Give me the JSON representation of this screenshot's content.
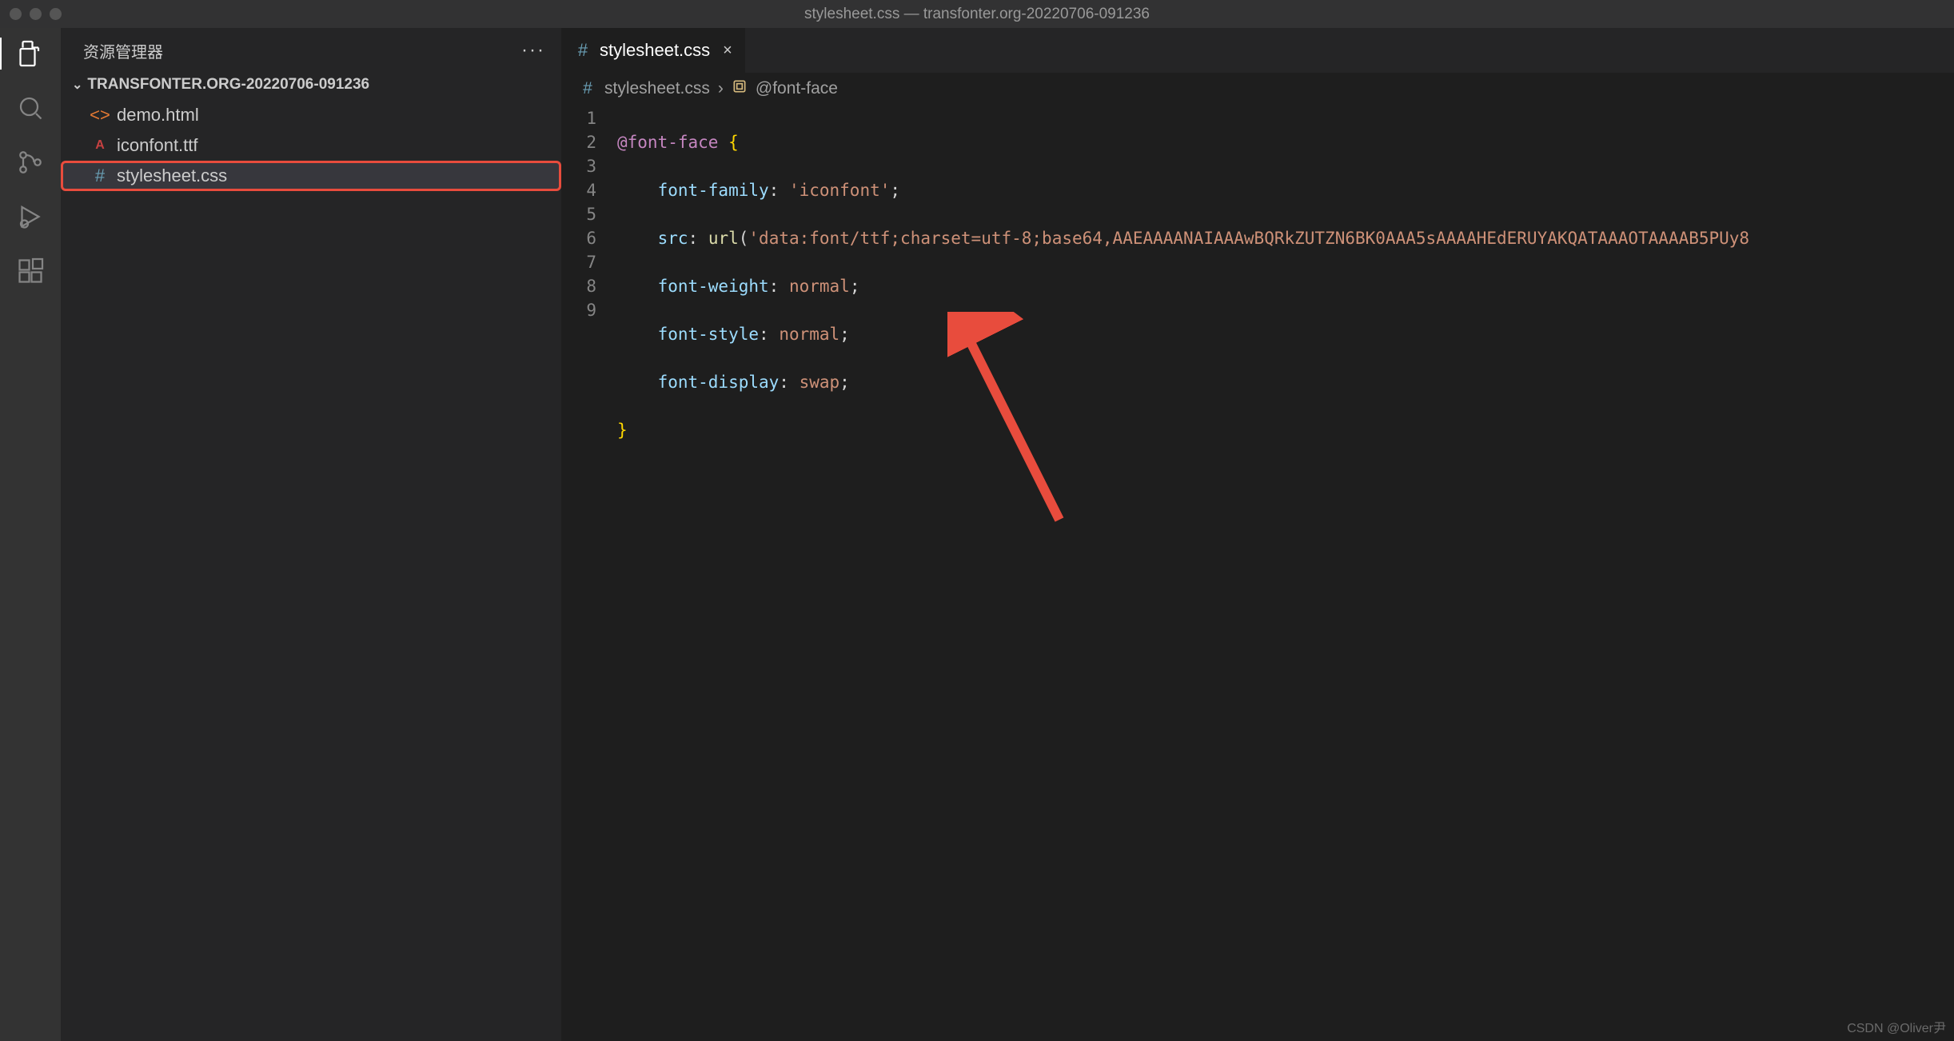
{
  "window": {
    "title": "stylesheet.css — transfonter.org-20220706-091236"
  },
  "sidebar": {
    "title": "资源管理器",
    "folder": "TRANSFONTER.ORG-20220706-091236",
    "files": [
      {
        "name": "demo.html",
        "icon": "html"
      },
      {
        "name": "iconfont.ttf",
        "icon": "ttf"
      },
      {
        "name": "stylesheet.css",
        "icon": "css",
        "selected": true
      }
    ]
  },
  "tabs": {
    "active": {
      "label": "stylesheet.css",
      "icon": "css"
    }
  },
  "breadcrumb": {
    "file": "stylesheet.css",
    "symbol": "@font-face"
  },
  "editor": {
    "line_numbers": [
      "1",
      "2",
      "3",
      "4",
      "5",
      "6",
      "7",
      "8",
      "9"
    ],
    "code": {
      "l1_atrule": "@font-face",
      "l1_brace": " {",
      "l2_prop": "font-family",
      "l2_val": "'iconfont'",
      "l3_prop": "src",
      "l3_fn": "url",
      "l3_val": "'data:font/ttf;charset=utf-8;base64,AAEAAAANAIAAAwBQRkZUTZN6BK0AAA5sAAAAHEdERUYAKQATAAAOTAAAAB5PUy8",
      "l4_prop": "font-weight",
      "l4_val": "normal",
      "l5_prop": "font-style",
      "l5_val": "normal",
      "l6_prop": "font-display",
      "l6_val": "swap",
      "l7_brace": "}"
    }
  },
  "watermark": "CSDN @Oliver尹"
}
